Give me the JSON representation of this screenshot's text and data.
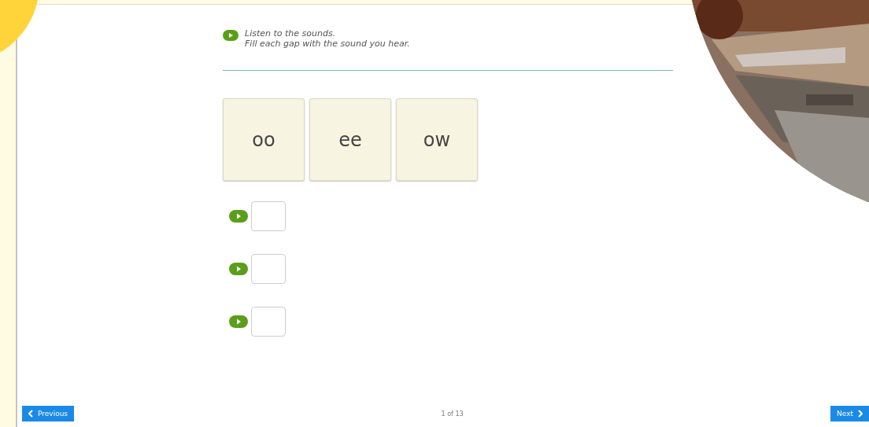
{
  "instructions": {
    "lines": [
      "Listen to the sounds.",
      "Fill each gap with the sound you hear."
    ]
  },
  "tiles": [
    {
      "label": "oo"
    },
    {
      "label": "ee"
    },
    {
      "label": "ow"
    }
  ],
  "gaps": [
    {
      "kind": "audio"
    },
    {
      "kind": "audio"
    },
    {
      "kind": "audio"
    }
  ],
  "footer": {
    "previous": "Previous",
    "counter": "1 of 13",
    "next": "Next"
  }
}
